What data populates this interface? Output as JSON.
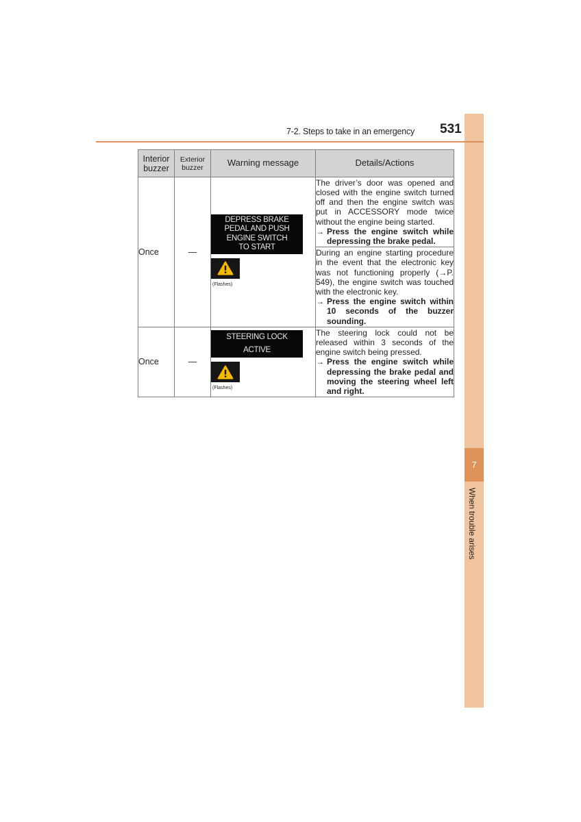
{
  "header": {
    "section": "7-2. Steps to take in an emergency",
    "page_number": "531"
  },
  "side_tab": {
    "chapter_number": "7",
    "chapter_title": "When trouble arises"
  },
  "colors": {
    "accent_rule": "#d9925a",
    "side_tab_light": "#efc49e",
    "side_tab_dark": "#df9359",
    "table_header_bg": "#d3d3d4",
    "warning_yellow": "#f5b800"
  },
  "table": {
    "headers": {
      "interior": "Interior buzzer",
      "exterior": "Exterior buzzer",
      "message": "Warning message",
      "details": "Details/Actions"
    },
    "rows": [
      {
        "interior": "Once",
        "exterior": "—",
        "display_lines": [
          "DEPRESS BRAKE",
          "PEDAL AND PUSH",
          "ENGINE SWITCH",
          "TO START"
        ],
        "icon": "warning-triangle-icon",
        "icon_caption": "(Flashes)",
        "details": [
          {
            "text": "The driver’s door was opened and closed with the engine switch turned off and then the engine switch was put in ACCESSORY mode twice without the engine being started.",
            "arrow": "→",
            "action": "Press the engine switch while depressing the brake pedal."
          },
          {
            "text": "During an engine starting procedure in the event that the electronic key was not functioning properly (→P. 549), the engine switch was touched with the electronic key.",
            "arrow": "→",
            "action": "Press the engine switch within 10 seconds of the buzzer sounding."
          }
        ]
      },
      {
        "interior": "Once",
        "exterior": "—",
        "display_lines": [
          "STEERING LOCK",
          "ACTIVE"
        ],
        "icon": "warning-triangle-icon",
        "icon_caption": "(Flashes)",
        "details": [
          {
            "text": "The steering lock could not be released within 3 seconds of the engine switch being pressed.",
            "arrow": "→",
            "action": "Press the engine switch while depressing the brake pedal and moving the steering wheel left and right."
          }
        ]
      }
    ]
  }
}
